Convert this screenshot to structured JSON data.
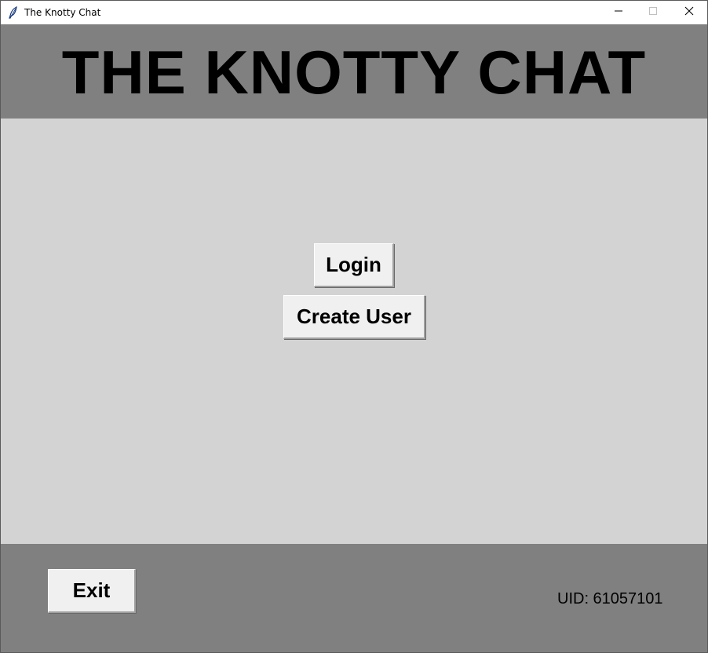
{
  "window": {
    "title": "The Knotty Chat",
    "icon": "feather-icon",
    "controls": {
      "minimize": "minimize-icon",
      "maximize": "maximize-icon",
      "close": "close-icon"
    }
  },
  "header": {
    "title": "THE KNOTTY CHAT"
  },
  "main": {
    "login_label": "Login",
    "create_user_label": "Create User"
  },
  "footer": {
    "exit_label": "Exit",
    "uid_text": "UID: 61057101"
  },
  "colors": {
    "header_bg": "#808080",
    "main_bg": "#d3d3d3",
    "footer_bg": "#808080",
    "button_bg": "#f0f0f0"
  }
}
